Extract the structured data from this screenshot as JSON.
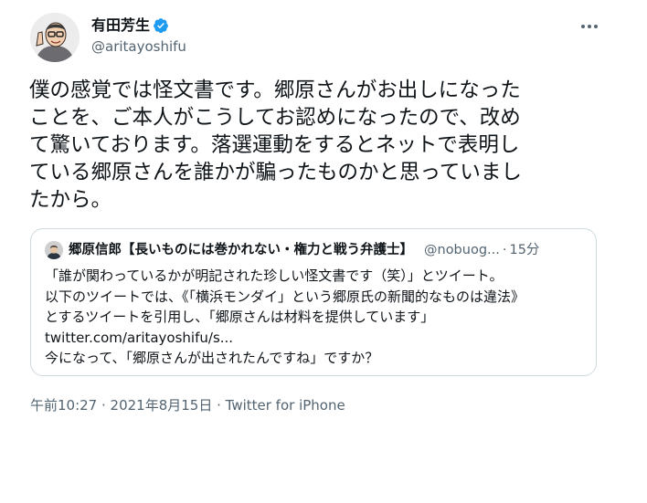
{
  "author": {
    "name": "有田芳生",
    "handle": "@aritayoshifu",
    "verified": true
  },
  "tweet": {
    "lines": [
      "僕の感覚では怪文書です。郷原さんがお出しになった",
      "ことを、ご本人がこうしてお認めになったので、改め",
      "て驚いております。落選運動をするとネットで表明し",
      "ている郷原さんを誰かが騙ったものかと思っていまし",
      "たから。"
    ]
  },
  "quote": {
    "name": "郷原信郎【長いものには巻かれない・権力と戦う弁護士】",
    "handle": "@nobuog...",
    "separator": "·",
    "time": "15分",
    "lines": [
      "「誰が関わっているかが明記された珍しい怪文書です（笑）」とツイート。",
      "以下のツイートでは、《「横浜モンダイ」という郷原氏の新聞的なものは違法》",
      "とするツイートを引用し、「郷原さんは材料を提供しています」",
      "twitter.com/aritayoshifu/s...",
      "今になって、「郷原さんが出されたんですね」ですか？"
    ]
  },
  "meta": {
    "timestamp": "午前10:27 · 2021年8月15日 · Twitter for iPhone"
  },
  "colors": {
    "verified": "#1d9bf0",
    "secondary_text": "#536471",
    "border": "#cfd9de"
  },
  "icons": {
    "verified": "verified-badge-icon",
    "more": "more-options-icon"
  }
}
